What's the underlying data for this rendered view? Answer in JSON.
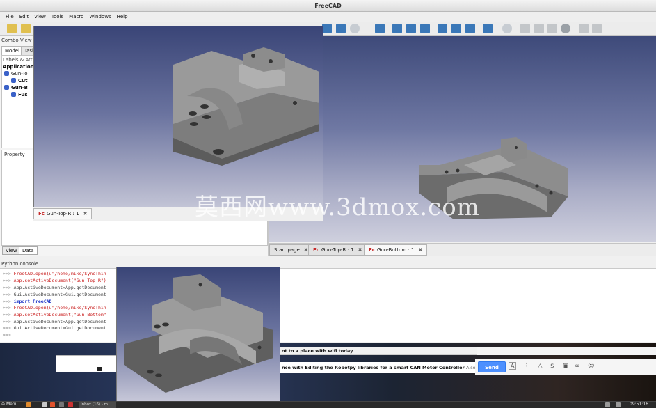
{
  "window": {
    "title": "FreeCAD"
  },
  "menu": [
    "File",
    "Edit",
    "View",
    "Tools",
    "Macro",
    "Windows",
    "Help"
  ],
  "combo_view": {
    "title": "Combo View",
    "tabs": [
      "Model",
      "Task"
    ],
    "tree_header": "Labels & Attr",
    "app_label": "Application",
    "tree_items": [
      "Gun-To",
      "Cut",
      "Gun-B",
      "Fus"
    ],
    "property_label": "Property",
    "bottom_tabs": [
      "View",
      "Data"
    ]
  },
  "doc_tabs": [
    {
      "label": "Start page",
      "active": false
    },
    {
      "label": "Gun-Top-R : 1",
      "active": false
    },
    {
      "label": "Gun-Bottom : 1",
      "active": true
    }
  ],
  "overlay_tab": "Gun-Top-R : 1",
  "console": {
    "title": "Python console",
    "lines": [
      {
        "prompt": ">>>",
        "code": "FreeCAD.open(u\"/home/mike/SyncThin",
        "kind": "str"
      },
      {
        "prompt": ">>>",
        "code": "App.setActiveDocument(\"Gun_Top_R\")",
        "kind": "str"
      },
      {
        "prompt": ">>>",
        "code": "App.ActiveDocument=App.getDocument",
        "kind": "plain"
      },
      {
        "prompt": ">>>",
        "code": "Gui.ActiveDocument=Gui.getDocument",
        "kind": "plain"
      },
      {
        "prompt": ">>>",
        "code": "import FreeCAD",
        "kind": "kw"
      },
      {
        "prompt": ">>>",
        "code": "FreeCAD.open(u\"/home/mike/SyncThin",
        "kind": "str"
      },
      {
        "prompt": ">>>",
        "code": "App.setActiveDocument(\"Gun_Bottom\"",
        "kind": "str"
      },
      {
        "prompt": ">>>",
        "code": "App.ActiveDocument=App.getDocument",
        "kind": "plain"
      },
      {
        "prompt": ">>>",
        "code": "Gui.ActiveDocument=Gui.getDocument",
        "kind": "plain"
      },
      {
        "prompt": ">>>",
        "code": "",
        "kind": "plain"
      }
    ]
  },
  "watermark": "莫西网www.3dmox.com",
  "mail": {
    "line1": "ot to a place with wifi today",
    "line2_bold": "nce with Editing the Robotpy libraries for a smart CAN Motor Controller",
    "line2_rest": "Also, for fu",
    "send_label": "Send"
  },
  "taskbar": {
    "menu_label": "Menu",
    "task_label": "Inbox (16) - m",
    "clock": "09:51:16"
  },
  "colors": {
    "viewport_top": "#3e4a7a",
    "viewport_bottom": "#cfd0de",
    "send_button": "#4d90fe",
    "part_face": "#8a8a8a"
  }
}
